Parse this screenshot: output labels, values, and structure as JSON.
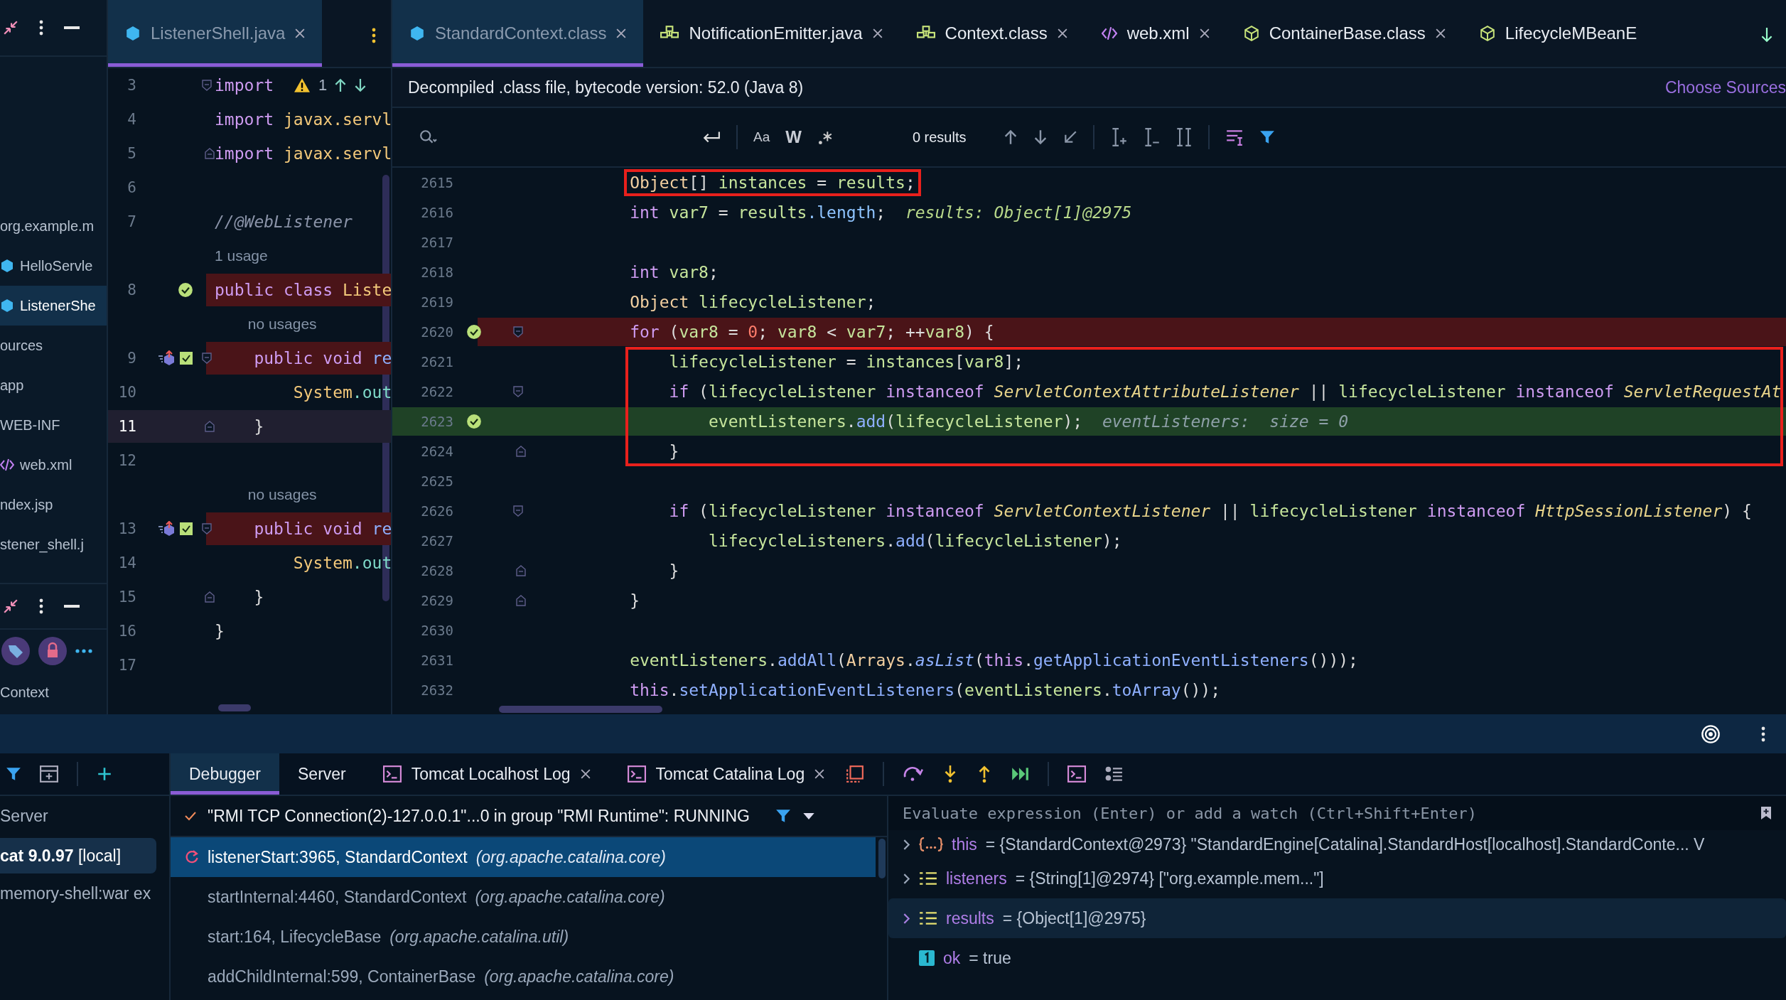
{
  "project_panel": {
    "items": [
      {
        "label": "org.example.m",
        "kind": "package",
        "selected": false
      },
      {
        "label": "HelloServle",
        "kind": "class",
        "selected": false
      },
      {
        "label": "ListenerShe",
        "kind": "class",
        "selected": true
      },
      {
        "label": "ources",
        "kind": "folder",
        "selected": false
      },
      {
        "label": "app",
        "kind": "folder",
        "selected": false
      },
      {
        "label": "WEB-INF",
        "kind": "folder",
        "selected": false
      },
      {
        "label": "web.xml",
        "kind": "xml",
        "selected": false
      },
      {
        "label": "ndex.jsp",
        "kind": "file",
        "selected": false
      },
      {
        "label": "stener_shell.j",
        "kind": "file",
        "selected": false
      }
    ],
    "lower_items": [
      {
        "label": "Context",
        "selected": false
      }
    ]
  },
  "left_editor": {
    "tabs": [
      {
        "label": "ListenerShell.java",
        "kind": "class",
        "selected": true,
        "closable": true
      }
    ],
    "lines": [
      {
        "kind": "code",
        "number": "3",
        "breakpoint": false,
        "current": false,
        "fold_start": true,
        "fold_end": false,
        "warning": "1",
        "segments": [
          {
            "text": "import",
            "kind": "kw"
          }
        ]
      },
      {
        "kind": "code",
        "number": "4",
        "breakpoint": false,
        "current": false,
        "fold_start": false,
        "fold_end": false,
        "segments": [
          {
            "text": "import ",
            "kind": "kw"
          },
          {
            "text": "javax.servl",
            "kind": "pkg"
          }
        ]
      },
      {
        "kind": "code",
        "number": "5",
        "breakpoint": false,
        "current": false,
        "fold_start": false,
        "fold_end": true,
        "segments": [
          {
            "text": "import ",
            "kind": "kw"
          },
          {
            "text": "javax.servl",
            "kind": "pkg"
          }
        ]
      },
      {
        "kind": "code",
        "number": "6",
        "breakpoint": false,
        "current": false,
        "fold_start": false,
        "fold_end": false
      },
      {
        "kind": "code",
        "number": "7",
        "breakpoint": false,
        "current": false,
        "fold_start": false,
        "fold_end": false,
        "segments": [
          {
            "text": "//@WebListener",
            "kind": "comment"
          }
        ]
      },
      {
        "kind": "hint",
        "text": "1 usage"
      },
      {
        "kind": "code",
        "number": "8",
        "breakpoint": true,
        "current": false,
        "fold_start": false,
        "fold_end": false,
        "segments": [
          {
            "text": "public class ",
            "kind": "kw"
          },
          {
            "text": "Liste",
            "kind": "pkg"
          }
        ],
        "children": [
          {
            "kind": "hint",
            "text": "no usages"
          },
          {
            "kind": "method",
            "number": "9",
            "breakpoint": true,
            "current": false,
            "fold_start": true,
            "fold_end": false,
            "segments": [
              {
                "text": "public void ",
                "kind": "kw"
              },
              {
                "text": "re",
                "kind": "method"
              }
            ],
            "children": [
              {
                "kind": "code",
                "number": "10",
                "breakpoint": false,
                "current": false,
                "fold_start": false,
                "fold_end": false,
                "segments": [
                  {
                    "text": "System",
                    "kind": "pkg"
                  },
                  {
                    "text": ".out",
                    "kind": "static"
                  }
                ]
              }
            ]
          },
          {
            "kind": "code",
            "number": "11",
            "breakpoint": false,
            "current": true,
            "fold_start": false,
            "fold_end": true,
            "segments": [
              {
                "text": "}",
                "kind": "plain"
              }
            ]
          },
          {
            "kind": "code",
            "number": "12",
            "breakpoint": false,
            "current": false,
            "fold_start": false,
            "fold_end": false
          },
          {
            "kind": "hint",
            "text": "no usages"
          },
          {
            "kind": "method",
            "number": "13",
            "breakpoint": true,
            "current": false,
            "fold_start": true,
            "fold_end": false,
            "segments": [
              {
                "text": "public void ",
                "kind": "kw"
              },
              {
                "text": "re",
                "kind": "method"
              }
            ],
            "children": [
              {
                "kind": "code",
                "number": "14",
                "breakpoint": false,
                "current": false,
                "fold_start": false,
                "fold_end": false,
                "segments": [
                  {
                    "text": "System",
                    "kind": "pkg"
                  },
                  {
                    "text": ".out",
                    "kind": "static"
                  }
                ]
              }
            ]
          },
          {
            "kind": "code",
            "number": "15",
            "breakpoint": false,
            "current": false,
            "fold_start": false,
            "fold_end": true,
            "segments": [
              {
                "text": "}",
                "kind": "plain"
              }
            ]
          }
        ]
      },
      {
        "kind": "code",
        "number": "16",
        "breakpoint": false,
        "current": false,
        "fold_start": false,
        "fold_end": false,
        "segments": [
          {
            "text": "}",
            "kind": "plain"
          }
        ]
      },
      {
        "kind": "code",
        "number": "17",
        "breakpoint": false,
        "current": false,
        "fold_start": false,
        "fold_end": false
      }
    ]
  },
  "right_editor": {
    "tabs": [
      {
        "label": "StandardContext.class",
        "kind": "class",
        "selected": true,
        "closable": true
      },
      {
        "label": "NotificationEmitter.java",
        "kind": "interface",
        "selected": false,
        "closable": true
      },
      {
        "label": "Context.class",
        "kind": "interface",
        "selected": false,
        "closable": true
      },
      {
        "label": "web.xml",
        "kind": "xml",
        "selected": false,
        "closable": true
      },
      {
        "label": "ContainerBase.class",
        "kind": "abstract",
        "selected": false,
        "closable": true
      },
      {
        "label": "LifecycleMBeanE",
        "kind": "abstract",
        "selected": false,
        "closable": false
      }
    ],
    "banner": {
      "text": "Decompiled .class file, bytecode version: 52.0 (Java 8)",
      "link": "Choose Sources"
    },
    "search": {
      "toggles": [
        "Aa",
        "W"
      ],
      "results": "0 results"
    },
    "lines": [
      {
        "number": "2615",
        "boxed": true,
        "breakpoint": false,
        "execution": false,
        "fold_start": false,
        "fold_end": false,
        "segments": [
          {
            "text": "Object",
            "kind": "type"
          },
          {
            "text": "[] ",
            "kind": "plain"
          },
          {
            "text": "instances",
            "kind": "var"
          },
          {
            "text": " = ",
            "kind": "plain"
          },
          {
            "text": "results",
            "kind": "var"
          },
          {
            "text": ";",
            "kind": "plain"
          }
        ]
      },
      {
        "number": "2616",
        "boxed": false,
        "breakpoint": false,
        "execution": false,
        "fold_start": false,
        "fold_end": false,
        "segments": [
          {
            "text": "int ",
            "kind": "kw"
          },
          {
            "text": "var7",
            "kind": "var"
          },
          {
            "text": " = ",
            "kind": "plain"
          },
          {
            "text": "results",
            "kind": "var"
          },
          {
            "text": ".length",
            "kind": "field"
          },
          {
            "text": ";",
            "kind": "plain"
          },
          {
            "text": "  results: Object[1]@2975",
            "kind": "hint"
          }
        ]
      },
      {
        "number": "2617",
        "boxed": false,
        "breakpoint": false,
        "execution": false,
        "fold_start": false,
        "fold_end": false
      },
      {
        "number": "2618",
        "boxed": false,
        "breakpoint": false,
        "execution": false,
        "fold_start": false,
        "fold_end": false,
        "segments": [
          {
            "text": "int ",
            "kind": "kw"
          },
          {
            "text": "var8",
            "kind": "var"
          },
          {
            "text": ";",
            "kind": "plain"
          }
        ]
      },
      {
        "number": "2619",
        "boxed": false,
        "breakpoint": false,
        "execution": false,
        "fold_start": false,
        "fold_end": false,
        "segments": [
          {
            "text": "Object ",
            "kind": "type"
          },
          {
            "text": "lifecycleListener",
            "kind": "var"
          },
          {
            "text": ";",
            "kind": "plain"
          }
        ]
      },
      {
        "number": "2620",
        "boxed": false,
        "breakpoint": true,
        "execution": false,
        "fold_start": true,
        "fold_end": false,
        "segments": [
          {
            "text": "for",
            "kind": "kw"
          },
          {
            "text": " (",
            "kind": "plain"
          },
          {
            "text": "var8",
            "kind": "var"
          },
          {
            "text": " = ",
            "kind": "plain"
          },
          {
            "text": "0",
            "kind": "num"
          },
          {
            "text": "; ",
            "kind": "plain"
          },
          {
            "text": "var8",
            "kind": "var"
          },
          {
            "text": " < ",
            "kind": "plain"
          },
          {
            "text": "var7",
            "kind": "var"
          },
          {
            "text": "; ++",
            "kind": "plain"
          },
          {
            "text": "var8",
            "kind": "var"
          },
          {
            "text": ") {",
            "kind": "plain"
          }
        ],
        "children": [
          {
            "number": "2621",
            "boxed": true,
            "breakpoint": false,
            "execution": false,
            "fold_start": false,
            "fold_end": false,
            "segments": [
              {
                "text": "lifecycleListener",
                "kind": "var"
              },
              {
                "text": " = ",
                "kind": "plain"
              },
              {
                "text": "instances",
                "kind": "var"
              },
              {
                "text": "[",
                "kind": "plain"
              },
              {
                "text": "var8",
                "kind": "var"
              },
              {
                "text": "];",
                "kind": "plain"
              }
            ]
          },
          {
            "number": "2622",
            "boxed": true,
            "breakpoint": false,
            "execution": false,
            "fold_start": true,
            "fold_end": false,
            "segments": [
              {
                "text": "if",
                "kind": "kw"
              },
              {
                "text": " (",
                "kind": "plain"
              },
              {
                "text": "lifecycleListener",
                "kind": "var"
              },
              {
                "text": " instanceof ",
                "kind": "kw"
              },
              {
                "text": "ServletContextAttributeListener",
                "kind": "itype"
              },
              {
                "text": " || ",
                "kind": "plain"
              },
              {
                "text": "lifecycleListener",
                "kind": "var"
              },
              {
                "text": " instanceof ",
                "kind": "kw"
              },
              {
                "text": "ServletRequestAt",
                "kind": "itype"
              }
            ],
            "children": [
              {
                "number": "2623",
                "boxed": true,
                "breakpoint": true,
                "execution": true,
                "fold_start": false,
                "fold_end": false,
                "segments": [
                  {
                    "text": "eventListeners",
                    "kind": "var"
                  },
                  {
                    "text": ".",
                    "kind": "plain"
                  },
                  {
                    "text": "add",
                    "kind": "method"
                  },
                  {
                    "text": "(",
                    "kind": "plain"
                  },
                  {
                    "text": "lifecycleListener",
                    "kind": "var"
                  },
                  {
                    "text": ");",
                    "kind": "plain"
                  },
                  {
                    "text": "  eventListeners:  size = 0",
                    "kind": "hint2"
                  }
                ]
              }
            ]
          },
          {
            "number": "2624",
            "boxed": true,
            "breakpoint": false,
            "execution": false,
            "fold_start": false,
            "fold_end": true,
            "segments": [
              {
                "text": "}",
                "kind": "plain"
              }
            ]
          },
          {
            "number": "2625",
            "boxed": false,
            "breakpoint": false,
            "execution": false,
            "fold_start": false,
            "fold_end": false
          },
          {
            "number": "2626",
            "boxed": false,
            "breakpoint": false,
            "execution": false,
            "fold_start": true,
            "fold_end": false,
            "segments": [
              {
                "text": "if",
                "kind": "kw"
              },
              {
                "text": " (",
                "kind": "plain"
              },
              {
                "text": "lifecycleListener",
                "kind": "var"
              },
              {
                "text": " instanceof ",
                "kind": "kw"
              },
              {
                "text": "ServletContextListener",
                "kind": "itype"
              },
              {
                "text": " || ",
                "kind": "plain"
              },
              {
                "text": "lifecycleListener",
                "kind": "var"
              },
              {
                "text": " instanceof ",
                "kind": "kw"
              },
              {
                "text": "HttpSessionListener",
                "kind": "itype"
              },
              {
                "text": ") {",
                "kind": "plain"
              }
            ],
            "children": [
              {
                "number": "2627",
                "boxed": false,
                "breakpoint": false,
                "execution": false,
                "fold_start": false,
                "fold_end": false,
                "segments": [
                  {
                    "text": "lifecycleListeners",
                    "kind": "var"
                  },
                  {
                    "text": ".",
                    "kind": "plain"
                  },
                  {
                    "text": "add",
                    "kind": "method"
                  },
                  {
                    "text": "(",
                    "kind": "plain"
                  },
                  {
                    "text": "lifecycleListener",
                    "kind": "var"
                  },
                  {
                    "text": ");",
                    "kind": "plain"
                  }
                ]
              }
            ]
          },
          {
            "number": "2628",
            "boxed": false,
            "breakpoint": false,
            "execution": false,
            "fold_start": false,
            "fold_end": true,
            "segments": [
              {
                "text": "}",
                "kind": "plain"
              }
            ]
          }
        ]
      },
      {
        "number": "2629",
        "boxed": false,
        "breakpoint": false,
        "execution": false,
        "fold_start": false,
        "fold_end": true,
        "segments": [
          {
            "text": "}",
            "kind": "plain"
          }
        ]
      },
      {
        "number": "2630",
        "boxed": false,
        "breakpoint": false,
        "execution": false,
        "fold_start": false,
        "fold_end": false
      },
      {
        "number": "2631",
        "boxed": false,
        "breakpoint": false,
        "execution": false,
        "fold_start": false,
        "fold_end": false,
        "segments": [
          {
            "text": "eventListeners",
            "kind": "var"
          },
          {
            "text": ".",
            "kind": "plain"
          },
          {
            "text": "addAll",
            "kind": "method"
          },
          {
            "text": "(",
            "kind": "plain"
          },
          {
            "text": "Arrays",
            "kind": "type"
          },
          {
            "text": ".",
            "kind": "plain"
          },
          {
            "text": "asList",
            "kind": "imethod"
          },
          {
            "text": "(",
            "kind": "plain"
          },
          {
            "text": "this",
            "kind": "kw"
          },
          {
            "text": ".",
            "kind": "plain"
          },
          {
            "text": "getApplicationEventListeners",
            "kind": "method"
          },
          {
            "text": "()));",
            "kind": "plain"
          }
        ]
      },
      {
        "number": "2632",
        "boxed": false,
        "breakpoint": false,
        "execution": false,
        "fold_start": false,
        "fold_end": false,
        "segments": [
          {
            "text": "this",
            "kind": "kw"
          },
          {
            "text": ".",
            "kind": "plain"
          },
          {
            "text": "setApplicationEventListeners",
            "kind": "method"
          },
          {
            "text": "(",
            "kind": "plain"
          },
          {
            "text": "eventListeners",
            "kind": "var"
          },
          {
            "text": ".",
            "kind": "plain"
          },
          {
            "text": "toArray",
            "kind": "method"
          },
          {
            "text": "());",
            "kind": "plain"
          }
        ]
      }
    ]
  },
  "debug_panel": {
    "tabs": [
      {
        "label": "Debugger",
        "kind": "plain",
        "selected": true,
        "closable": false
      },
      {
        "label": "Server",
        "kind": "plain",
        "selected": false,
        "closable": false
      },
      {
        "label": "Tomcat Localhost Log",
        "kind": "log",
        "selected": false,
        "closable": true
      },
      {
        "label": "Tomcat Catalina Log",
        "kind": "log",
        "selected": false,
        "closable": true
      }
    ],
    "services": {
      "header": "Server",
      "items": [
        {
          "label": "**cat 9.0.97** [local]",
          "selected": true
        },
        {
          "label": "memory-shell:war ex",
          "selected": false
        }
      ]
    },
    "thread": "\"RMI TCP Connection(2)-127.0.0.1\"...0 in group \"RMI Runtime\": RUNNING",
    "frames": [
      {
        "method": "listenerStart:3965, StandardContext",
        "package": "(org.apache.catalina.core)",
        "selected": true
      },
      {
        "method": "startInternal:4460, StandardContext",
        "package": "(org.apache.catalina.core)",
        "selected": false
      },
      {
        "method": "start:164, LifecycleBase",
        "package": "(org.apache.catalina.util)",
        "selected": false
      },
      {
        "method": "addChildInternal:599, ContainerBase",
        "package": "(org.apache.catalina.core)",
        "selected": false
      }
    ],
    "evaluate": {
      "placeholder": "Evaluate expression (Enter) or add a watch (Ctrl+Shift+Enter)"
    },
    "variables": [
      {
        "kind": "object",
        "name": "this",
        "value": "= {StandardContext@2973} \"StandardEngine[Catalina].StandardHost[localhost].StandardConte... V",
        "selected": false
      },
      {
        "kind": "array",
        "name": "listeners",
        "value": "= {String[1]@2974} [\"org.example.mem...\"]",
        "selected": false
      },
      {
        "kind": "array",
        "name": "results",
        "value": "= {Object[1]@2975}",
        "selected": true
      },
      {
        "kind": "primitive",
        "name": "ok",
        "value": "= true",
        "selected": false
      }
    ]
  }
}
